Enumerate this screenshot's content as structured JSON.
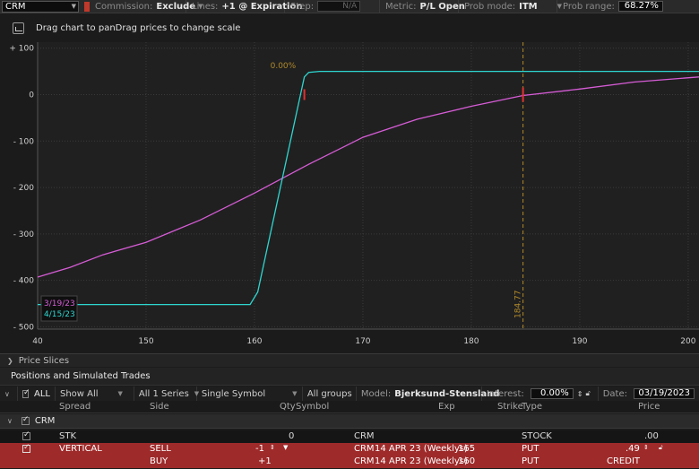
{
  "toolbar": {
    "symbol": "CRM",
    "commission_label": "Commission:",
    "commission_value": "Exclude",
    "lines_label": "Lines:",
    "lines_value": "+1 @ Expiration",
    "step_label": "Step:",
    "step_value": "N/A",
    "metric_label": "Metric:",
    "metric_value": "P/L Open",
    "prob_mode_label": "Prob mode:",
    "prob_mode_value": "ITM",
    "prob_range_label": "Prob range:",
    "prob_range_value": "68.27%"
  },
  "hint": {
    "text": "Drag chart to panDrag prices to change scale"
  },
  "chart_data": {
    "type": "line",
    "y_ticks": [
      "+ 100",
      "0",
      "- 100",
      "- 200",
      "- 300",
      "- 400",
      "- 500"
    ],
    "y_tick_values": [
      100,
      0,
      -100,
      -200,
      -300,
      -400,
      -500
    ],
    "x_ticks": [
      "40",
      "150",
      "160",
      "170",
      "180",
      "190",
      "200"
    ],
    "x_tick_values": [
      140,
      150,
      160,
      170,
      180,
      190,
      200
    ],
    "xlim": [
      140,
      201
    ],
    "ylim": [
      -505,
      113
    ],
    "grid": true,
    "marker_label": "184.77",
    "marker_x": 184.77,
    "prob_label": "0.00%",
    "series": [
      {
        "name": "3/19/23",
        "color": "#d65cd6",
        "x": [
          140,
          143,
          146,
          150,
          155,
          160,
          165,
          170,
          175,
          180,
          184.77,
          190,
          195,
          201
        ],
        "y": [
          -393,
          -372,
          -345,
          -318,
          -270,
          -212,
          -150,
          -92,
          -53,
          -25,
          -2,
          12,
          27,
          38
        ]
      },
      {
        "name": "4/15/23",
        "color": "#2ed6d0",
        "x": [
          140,
          159.6,
          160.3,
          164.6,
          165.0,
          166.0,
          201
        ],
        "y": [
          -452,
          -452,
          -425,
          38,
          48,
          50,
          50
        ]
      }
    ],
    "legend": [
      "3/19/23",
      "4/15/23"
    ]
  },
  "lower": {
    "price_slices": "Price Slices",
    "positions_title": "Positions and Simulated Trades",
    "filter": {
      "all": "ALL",
      "show": "Show All",
      "series": "All 1 Series",
      "symbol": "Single Symbol",
      "groups": "All groups",
      "model_label": "Model:",
      "model_value": "Bjerksund-Stensland",
      "interest_label": "Interest:",
      "interest_value": "0.00%",
      "date_label": "Date:",
      "date_value": "03/19/2023"
    },
    "columns": {
      "spread": "Spread",
      "side": "Side",
      "qty": "Qty",
      "symbol": "Symbol",
      "exp": "Exp",
      "strike": "Strike",
      "type": "Type",
      "price": "Price"
    },
    "group": "CRM",
    "rows": [
      {
        "spread": "STK",
        "side": "",
        "qty": "0",
        "symbol": "CRM",
        "exp": "",
        "strike": "",
        "type": "STOCK",
        "price": ".00"
      },
      {
        "spread": "VERTICAL",
        "side": "SELL",
        "qty": "-1",
        "symbol": "CRM",
        "exp": "14 APR 23 (Weeklys)",
        "strike": "165",
        "type": "PUT",
        "price": ".49"
      },
      {
        "spread": "",
        "side": "BUY",
        "qty": "+1",
        "symbol": "CRM",
        "exp": "14 APR 23 (Weeklys)",
        "strike": "160",
        "type": "PUT",
        "price": "CREDIT"
      }
    ]
  }
}
